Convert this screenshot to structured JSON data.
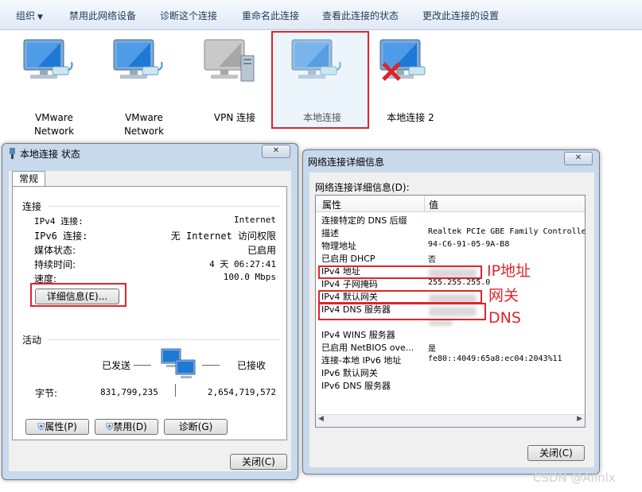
{
  "toolbar": {
    "organize": "组织",
    "disable": "禁用此网络设备",
    "diagnose": "诊断这个连接",
    "rename": "重命名此连接",
    "view_status": "查看此连接的状态",
    "change_settings": "更改此连接的设置"
  },
  "adapters": [
    {
      "line1": "VMware",
      "line2": "Network"
    },
    {
      "line1": "VMware",
      "line2": "Network"
    },
    {
      "line1": "VPN 连接",
      "line2": ""
    },
    {
      "line1": "本地连接",
      "line2": ""
    },
    {
      "line1": "本地连接 2",
      "line2": ""
    }
  ],
  "status_dialog": {
    "title": "本地连接 状态",
    "close_x": "✕",
    "tab": "常规",
    "connection_heading": "连接",
    "rows": [
      {
        "label": "IPv4 连接:",
        "value": "Internet"
      },
      {
        "label": "IPv6 连接:",
        "value": "无 Internet 访问权限"
      },
      {
        "label": "媒体状态:",
        "value": "已启用"
      },
      {
        "label": "持续时间:",
        "value": "4 天 06:27:41"
      },
      {
        "label": "速度:",
        "value": "100.0 Mbps"
      }
    ],
    "details_button": "详细信息(E)...",
    "activity_heading": "活动",
    "sent": "已发送",
    "received": "已接收",
    "bytes_label": "字节:",
    "bytes_sent": "831,799,235",
    "bytes_received": "2,654,719,572",
    "properties_button": "属性(P)",
    "disable_button": "禁用(D)",
    "diagnose_button": "诊断(G)",
    "close_button": "关闭(C)"
  },
  "details_dialog": {
    "title": "网络连接详细信息",
    "close_x": "✕",
    "subtitle": "网络连接详细信息(D):",
    "col_property": "属性",
    "col_value": "值",
    "rows": [
      {
        "p": "连接特定的 DNS 后缀",
        "v": ""
      },
      {
        "p": "描述",
        "v": "Realtek PCIe GBE Family Controlle"
      },
      {
        "p": "物理地址",
        "v": "94-C6-91-05-9A-B8"
      },
      {
        "p": "已启用 DHCP",
        "v": "否"
      },
      {
        "p": "IPv4 地址",
        "v": ""
      },
      {
        "p": "IPv4 子网掩码",
        "v": "255.255.255.0"
      },
      {
        "p": "IPv4 默认网关",
        "v": ""
      },
      {
        "p": "IPv4 DNS 服务器",
        "v": ""
      },
      {
        "p": "",
        "v": ""
      },
      {
        "p": "IPv4 WINS 服务器",
        "v": ""
      },
      {
        "p": "已启用 NetBIOS ove...",
        "v": "是"
      },
      {
        "p": "连接-本地 IPv6 地址",
        "v": "fe80::4049:65a8:ec04:2043%11"
      },
      {
        "p": "IPv6 默认网关",
        "v": ""
      },
      {
        "p": "IPv6 DNS 服务器",
        "v": ""
      }
    ],
    "close_button": "关闭(C)"
  },
  "annotations": {
    "ip": "IP地址",
    "gateway": "网关",
    "dns": "DNS"
  },
  "watermark": "CSDN @Alinlx",
  "colors": {
    "highlight": "#e0242a",
    "accent": "#1e395b"
  }
}
